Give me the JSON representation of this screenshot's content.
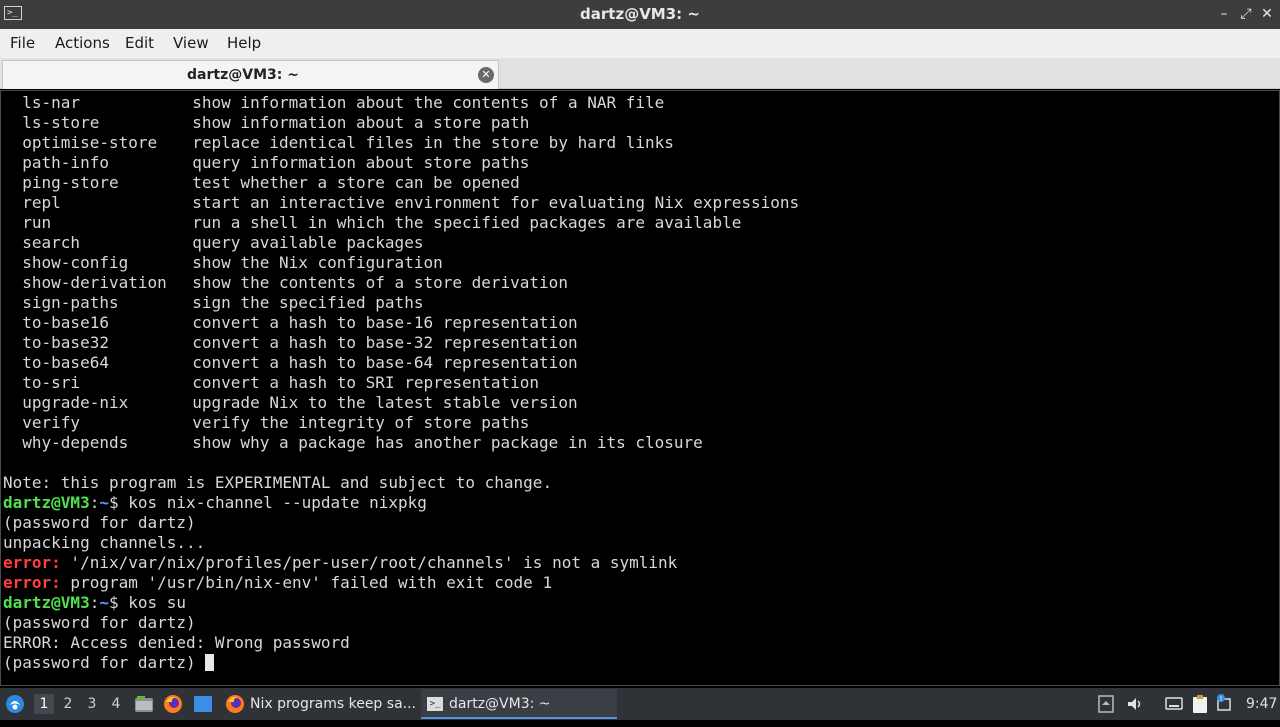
{
  "window": {
    "title": "dartz@VM3: ~"
  },
  "menu": [
    "File",
    "Actions",
    "Edit",
    "View",
    "Help"
  ],
  "tab": {
    "title": "dartz@VM3: ~"
  },
  "terminal": {
    "commands": [
      {
        "cmd": "ls-nar",
        "desc": "show information about the contents of a NAR file"
      },
      {
        "cmd": "ls-store",
        "desc": "show information about a store path"
      },
      {
        "cmd": "optimise-store",
        "desc": "replace identical files in the store by hard links"
      },
      {
        "cmd": "path-info",
        "desc": "query information about store paths"
      },
      {
        "cmd": "ping-store",
        "desc": "test whether a store can be opened"
      },
      {
        "cmd": "repl",
        "desc": "start an interactive environment for evaluating Nix expressions"
      },
      {
        "cmd": "run",
        "desc": "run a shell in which the specified packages are available"
      },
      {
        "cmd": "search",
        "desc": "query available packages"
      },
      {
        "cmd": "show-config",
        "desc": "show the Nix configuration"
      },
      {
        "cmd": "show-derivation",
        "desc": "show the contents of a store derivation"
      },
      {
        "cmd": "sign-paths",
        "desc": "sign the specified paths"
      },
      {
        "cmd": "to-base16",
        "desc": "convert a hash to base-16 representation"
      },
      {
        "cmd": "to-base32",
        "desc": "convert a hash to base-32 representation"
      },
      {
        "cmd": "to-base64",
        "desc": "convert a hash to base-64 representation"
      },
      {
        "cmd": "to-sri",
        "desc": "convert a hash to SRI representation"
      },
      {
        "cmd": "upgrade-nix",
        "desc": "upgrade Nix to the latest stable version"
      },
      {
        "cmd": "verify",
        "desc": "verify the integrity of store paths"
      },
      {
        "cmd": "why-depends",
        "desc": "show why a package has another package in its closure"
      }
    ],
    "note": "Note: this program is EXPERIMENTAL and subject to change.",
    "prompt_user": "dartz@VM3",
    "prompt_path": "~",
    "prompt_end": "$",
    "cmd1": " kos nix-channel --update nixpkg",
    "pw1": "(password for dartz)",
    "unpacking": "unpacking channels...",
    "error_label": "error:",
    "err1": " '/nix/var/nix/profiles/per-user/root/channels' is not a symlink",
    "err2": " program '/usr/bin/nix-env' failed with exit code 1",
    "cmd2": " kos su",
    "pw2": "(password for dartz)",
    "access_denied": "ERROR: Access denied: Wrong password",
    "pw3": "(password for dartz) "
  },
  "taskbar": {
    "workspaces": [
      "1",
      "2",
      "3",
      "4"
    ],
    "tasks": [
      "Nix programs keep sa...",
      "dartz@VM3: ~"
    ],
    "clock": "9:47"
  },
  "colors": {
    "prompt_user": "#4ee04e",
    "prompt_path": "#5a9cff",
    "error": "#ff4040"
  }
}
